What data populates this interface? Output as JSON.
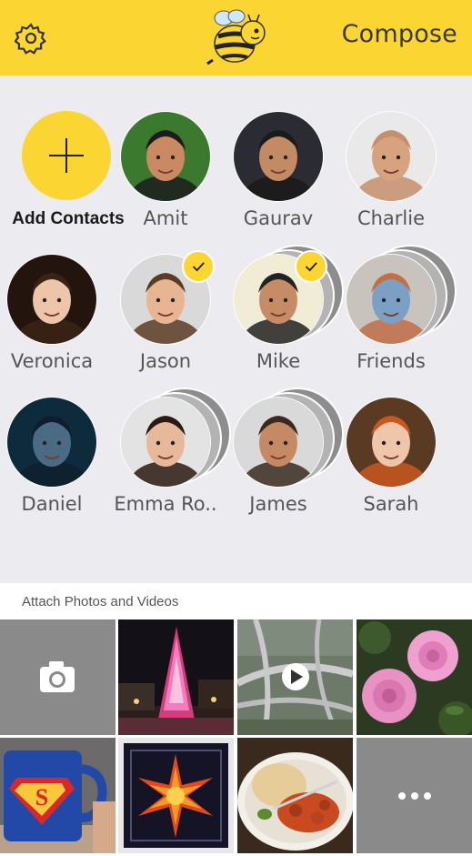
{
  "header": {
    "compose_label": "Compose",
    "settings_icon": "gear-icon",
    "logo_icon": "bee-logo"
  },
  "add_contacts": {
    "label": "Add Contacts",
    "icon": "plus-icon"
  },
  "contacts": [
    {
      "name": "Amit",
      "selected": false,
      "group": false
    },
    {
      "name": "Gaurav",
      "selected": false,
      "group": false
    },
    {
      "name": "Charlie",
      "selected": false,
      "group": false
    },
    {
      "name": "Veronica",
      "selected": false,
      "group": false
    },
    {
      "name": "Jason",
      "selected": true,
      "group": false
    },
    {
      "name": "Mike",
      "selected": true,
      "group": true
    },
    {
      "name": "Friends",
      "selected": false,
      "group": true
    },
    {
      "name": "Daniel",
      "selected": false,
      "group": false
    },
    {
      "name": "Emma Ro..",
      "selected": false,
      "group": true
    },
    {
      "name": "James",
      "selected": false,
      "group": true
    },
    {
      "name": "Sarah",
      "selected": false,
      "group": false
    }
  ],
  "attach": {
    "label": "Attach Photos and Videos"
  },
  "photos": [
    {
      "kind": "camera",
      "icon": "camera-icon"
    },
    {
      "kind": "photo",
      "subject": "christmas tree"
    },
    {
      "kind": "video",
      "icon": "play-icon"
    },
    {
      "kind": "photo",
      "subject": "pink roses"
    },
    {
      "kind": "photo",
      "subject": "superman mug"
    },
    {
      "kind": "photo",
      "subject": "sun tile"
    },
    {
      "kind": "photo",
      "subject": "food plate"
    },
    {
      "kind": "more",
      "icon": "more-icon"
    }
  ],
  "colors": {
    "accent": "#fbd632",
    "background": "#ebebf0",
    "check": "#1a1a1a"
  }
}
